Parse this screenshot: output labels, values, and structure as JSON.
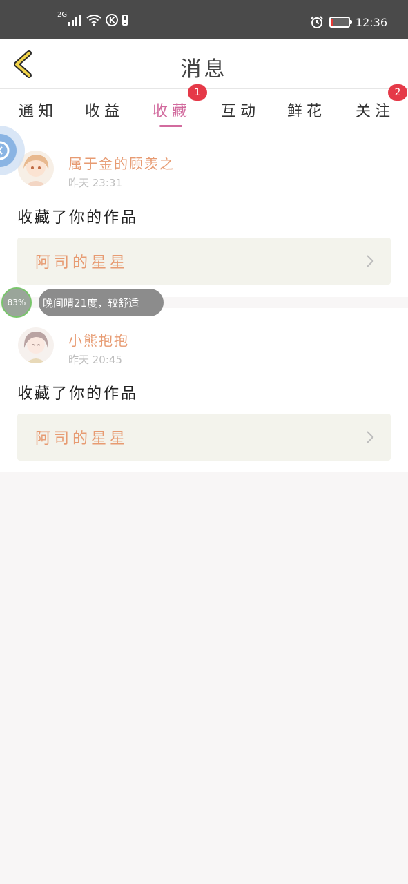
{
  "status_bar": {
    "network": "2G",
    "time": "12:36",
    "k_label": "K"
  },
  "header": {
    "title": "消息"
  },
  "tabs": [
    {
      "label": "通知"
    },
    {
      "label": "收益"
    },
    {
      "label": "收藏",
      "badge": "1"
    },
    {
      "label": "互动"
    },
    {
      "label": "鲜花"
    },
    {
      "label": "关注",
      "badge": "2"
    }
  ],
  "messages": [
    {
      "user": "属于金的顾羡之",
      "time": "昨天 23:31",
      "action": "收藏了你的作品",
      "work": "阿司的星星"
    },
    {
      "user": "小熊抱抱",
      "time": "昨天 20:45",
      "action": "收藏了你的作品",
      "work": "阿司的星星"
    }
  ],
  "weather_widget": {
    "percent": "83%",
    "text": "晚间晴21度，较舒适"
  },
  "colors": {
    "accent": "#d26b9e",
    "name": "#e79b72",
    "badge": "#e53948"
  }
}
